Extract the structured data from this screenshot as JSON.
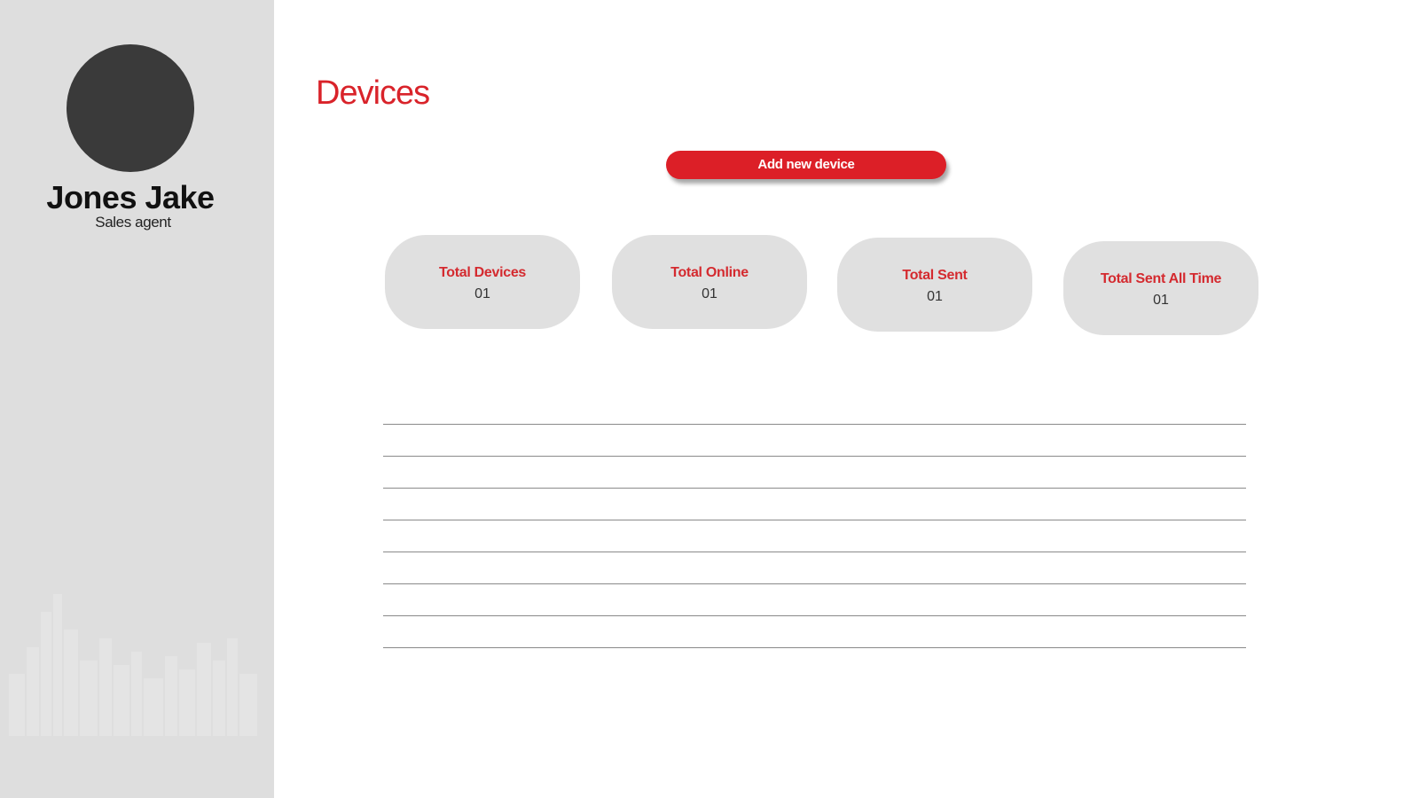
{
  "sidebar": {
    "user": {
      "name": "Jones  Jake",
      "role": "Sales agent"
    }
  },
  "main": {
    "title": "Devices",
    "add_button_label": "Add new device",
    "stats": [
      {
        "label": "Total Devices",
        "value": "01"
      },
      {
        "label": "Total Online",
        "value": "01"
      },
      {
        "label": "Total Sent",
        "value": "01"
      },
      {
        "label": "Total Sent All Time",
        "value": "01"
      }
    ],
    "list_rows": 8
  },
  "colors": {
    "accent": "#dc1f27",
    "sidebar_bg": "#dedede",
    "card_bg": "#e0e0e0",
    "avatar": "#3a3a3a"
  }
}
